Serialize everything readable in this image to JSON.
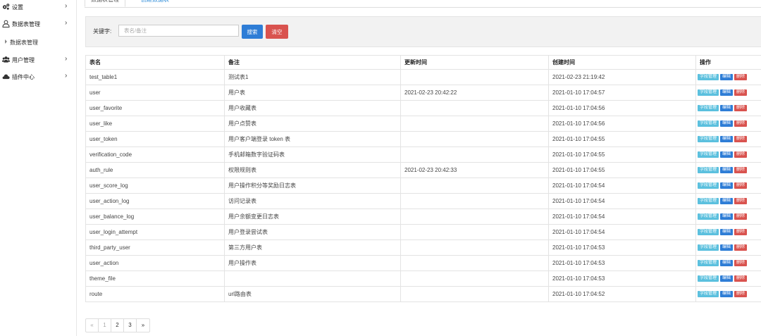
{
  "sidebar": {
    "items": [
      {
        "label": "设置",
        "icon": "gears-icon"
      },
      {
        "label": "数据表管理",
        "icon": "user-outline-icon"
      },
      {
        "label": "数据表管理",
        "icon": "triangle-right-icon"
      },
      {
        "label": "用户管理",
        "icon": "users-icon"
      },
      {
        "label": "插件中心",
        "icon": "cloud-icon"
      }
    ],
    "chevron": "›"
  },
  "tabs": {
    "active_label": "数据表管理",
    "link_label": "创建数据表"
  },
  "search": {
    "label": "关键字:",
    "placeholder": "表名/备注",
    "value": "",
    "search_button": "搜索",
    "clear_button": "清空"
  },
  "table": {
    "columns": [
      "表名",
      "备注",
      "更新时间",
      "创建时间",
      "操作"
    ],
    "action_labels": {
      "field": "字段管理",
      "edit": "编辑",
      "delete": "删除"
    },
    "rows": [
      {
        "name": "test_table1",
        "comment": "测试表1",
        "updated": "",
        "created": "2021-02-23 21:19:42"
      },
      {
        "name": "user",
        "comment": "用户表",
        "updated": "2021-02-23 20:42:22",
        "created": "2021-01-10 17:04:57"
      },
      {
        "name": "user_favorite",
        "comment": "用户收藏表",
        "updated": "",
        "created": "2021-01-10 17:04:56"
      },
      {
        "name": "user_like",
        "comment": "用户点赞表",
        "updated": "",
        "created": "2021-01-10 17:04:56"
      },
      {
        "name": "user_token",
        "comment": "用户客户端登录 token 表",
        "updated": "",
        "created": "2021-01-10 17:04:55"
      },
      {
        "name": "verification_code",
        "comment": "手机邮箱数字验证码表",
        "updated": "",
        "created": "2021-01-10 17:04:55"
      },
      {
        "name": "auth_rule",
        "comment": "权限规则表",
        "updated": "2021-02-23 20:42:33",
        "created": "2021-01-10 17:04:55"
      },
      {
        "name": "user_score_log",
        "comment": "用户操作积分等奖励日志表",
        "updated": "",
        "created": "2021-01-10 17:04:54"
      },
      {
        "name": "user_action_log",
        "comment": "访问记录表",
        "updated": "",
        "created": "2021-01-10 17:04:54"
      },
      {
        "name": "user_balance_log",
        "comment": "用户余额变更日志表",
        "updated": "",
        "created": "2021-01-10 17:04:54"
      },
      {
        "name": "user_login_attempt",
        "comment": "用户登录尝试表",
        "updated": "",
        "created": "2021-01-10 17:04:54"
      },
      {
        "name": "third_party_user",
        "comment": "第三方用户表",
        "updated": "",
        "created": "2021-01-10 17:04:53"
      },
      {
        "name": "user_action",
        "comment": "用户操作表",
        "updated": "",
        "created": "2021-01-10 17:04:53"
      },
      {
        "name": "theme_file",
        "comment": "",
        "updated": "",
        "created": "2021-01-10 17:04:53"
      },
      {
        "name": "route",
        "comment": "url路由表",
        "updated": "",
        "created": "2021-01-10 17:04:52"
      }
    ]
  },
  "pagination": {
    "prev": "«",
    "pages": [
      "1",
      "2",
      "3"
    ],
    "current": "1",
    "next": "»"
  }
}
